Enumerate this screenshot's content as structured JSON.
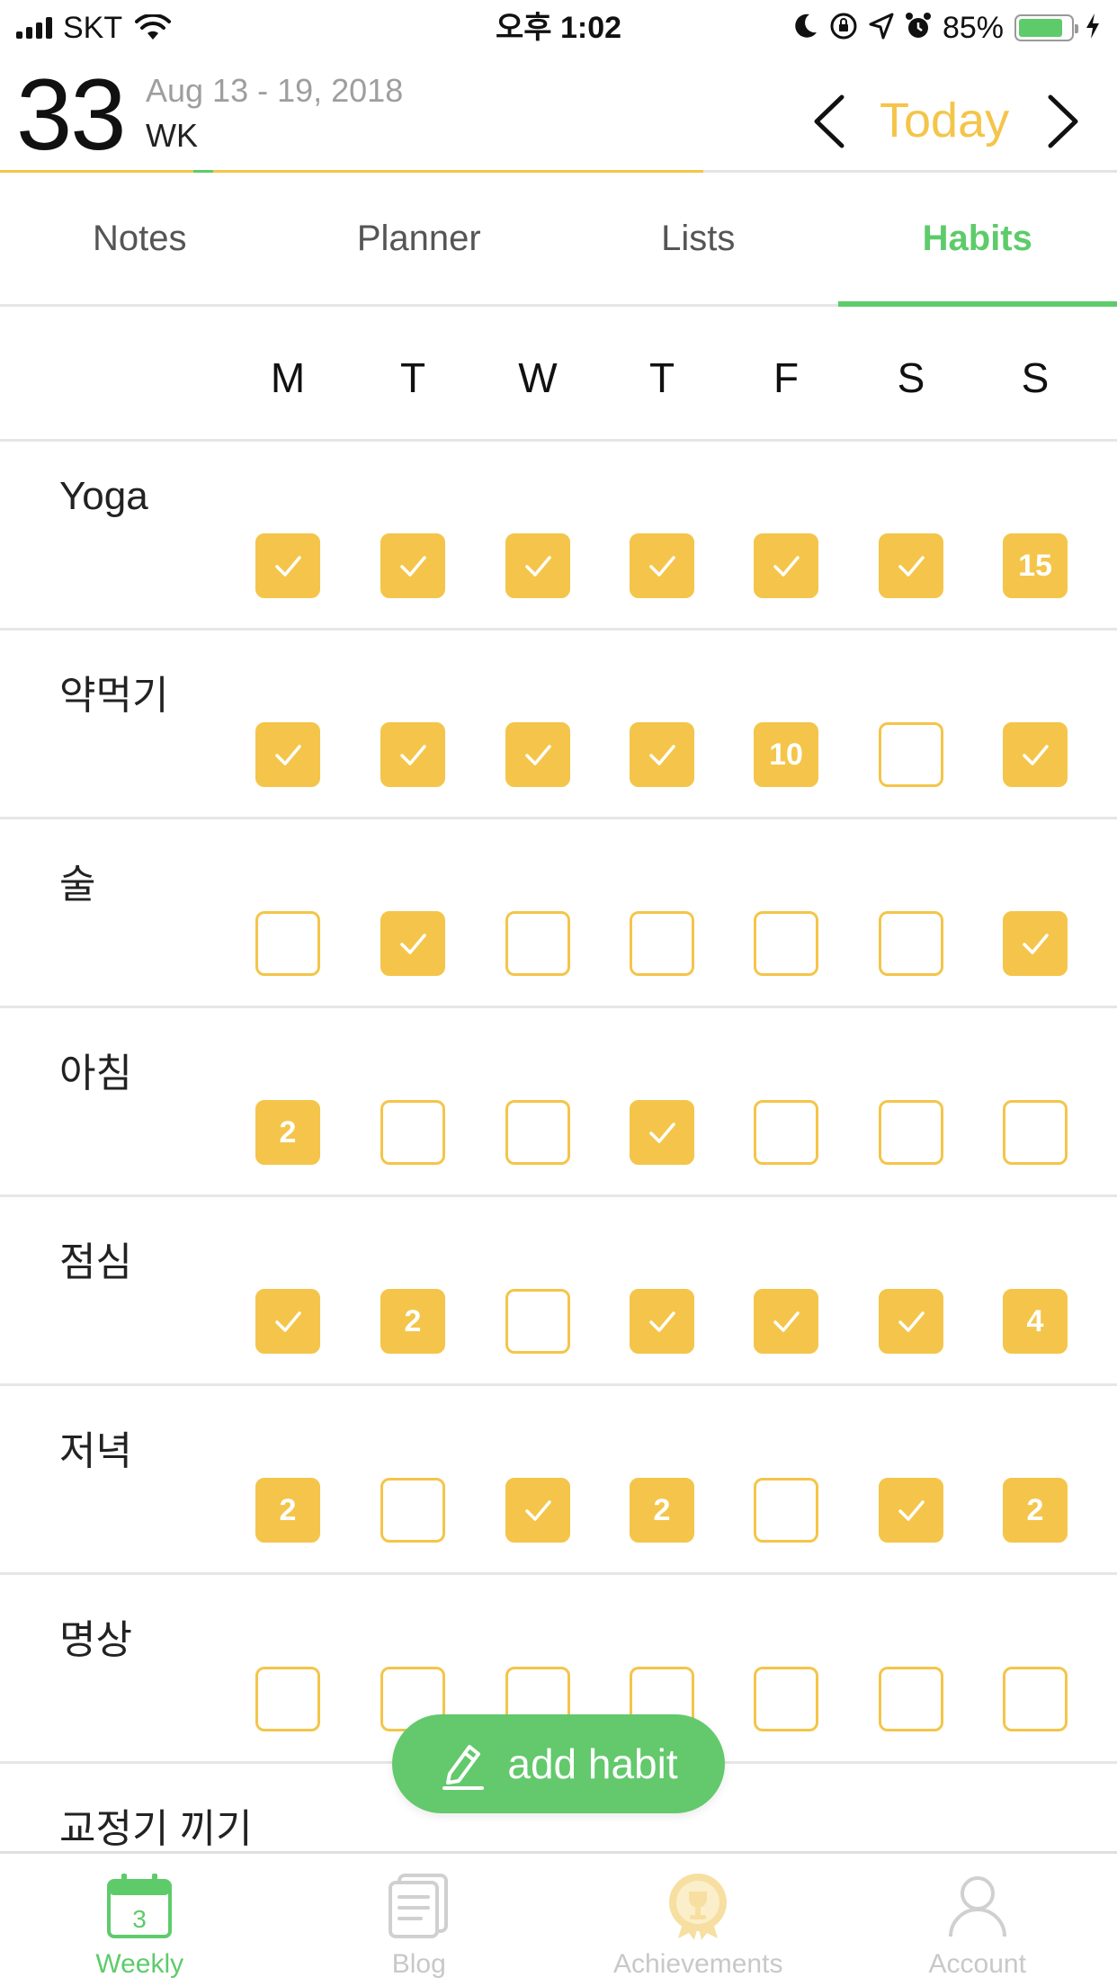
{
  "status_bar": {
    "carrier": "SKT",
    "time": "오후 1:02",
    "battery_percent": "85%",
    "battery_level": 0.85
  },
  "week_header": {
    "week_number": "33",
    "date_range": "Aug 13 - 19, 2018",
    "week_label": "WK",
    "today_label": "Today",
    "week_progress": 0.63
  },
  "tabs": [
    {
      "label": "Notes",
      "active": false
    },
    {
      "label": "Planner",
      "active": false
    },
    {
      "label": "Lists",
      "active": false
    },
    {
      "label": "Habits",
      "active": true
    }
  ],
  "days": [
    "M",
    "T",
    "W",
    "T",
    "F",
    "S",
    "S"
  ],
  "habits": [
    {
      "name": "Yoga",
      "days": [
        "check",
        "check",
        "check",
        "check",
        "check",
        "check",
        "15"
      ]
    },
    {
      "name": "약먹기",
      "days": [
        "check",
        "check",
        "check",
        "check",
        "10",
        "empty",
        "check"
      ]
    },
    {
      "name": "술",
      "days": [
        "empty",
        "check",
        "empty",
        "empty",
        "empty",
        "empty",
        "check"
      ]
    },
    {
      "name": "아침",
      "days": [
        "2",
        "empty",
        "empty",
        "check",
        "empty",
        "empty",
        "empty"
      ]
    },
    {
      "name": "점심",
      "days": [
        "check",
        "2",
        "empty",
        "check",
        "check",
        "check",
        "4"
      ]
    },
    {
      "name": "저녁",
      "days": [
        "2",
        "empty",
        "check",
        "2",
        "empty",
        "check",
        "2"
      ]
    },
    {
      "name": "명상",
      "days": [
        "empty",
        "empty",
        "empty",
        "empty",
        "empty",
        "empty",
        "empty"
      ]
    },
    {
      "name": "교정기 끼기",
      "days": []
    }
  ],
  "add_habit": {
    "label": "add habit"
  },
  "bottom_bar": [
    {
      "label": "Weekly",
      "icon": "calendar-icon",
      "active": true,
      "badge": "3"
    },
    {
      "label": "Blog",
      "icon": "notebook-icon",
      "active": false
    },
    {
      "label": "Achievements",
      "icon": "trophy-medal-icon",
      "active": false
    },
    {
      "label": "Account",
      "icon": "person-icon",
      "active": false
    }
  ],
  "colors": {
    "accent_yellow": "#f4c54a",
    "accent_green": "#5ecb6b",
    "divider": "#e6e6e6"
  }
}
